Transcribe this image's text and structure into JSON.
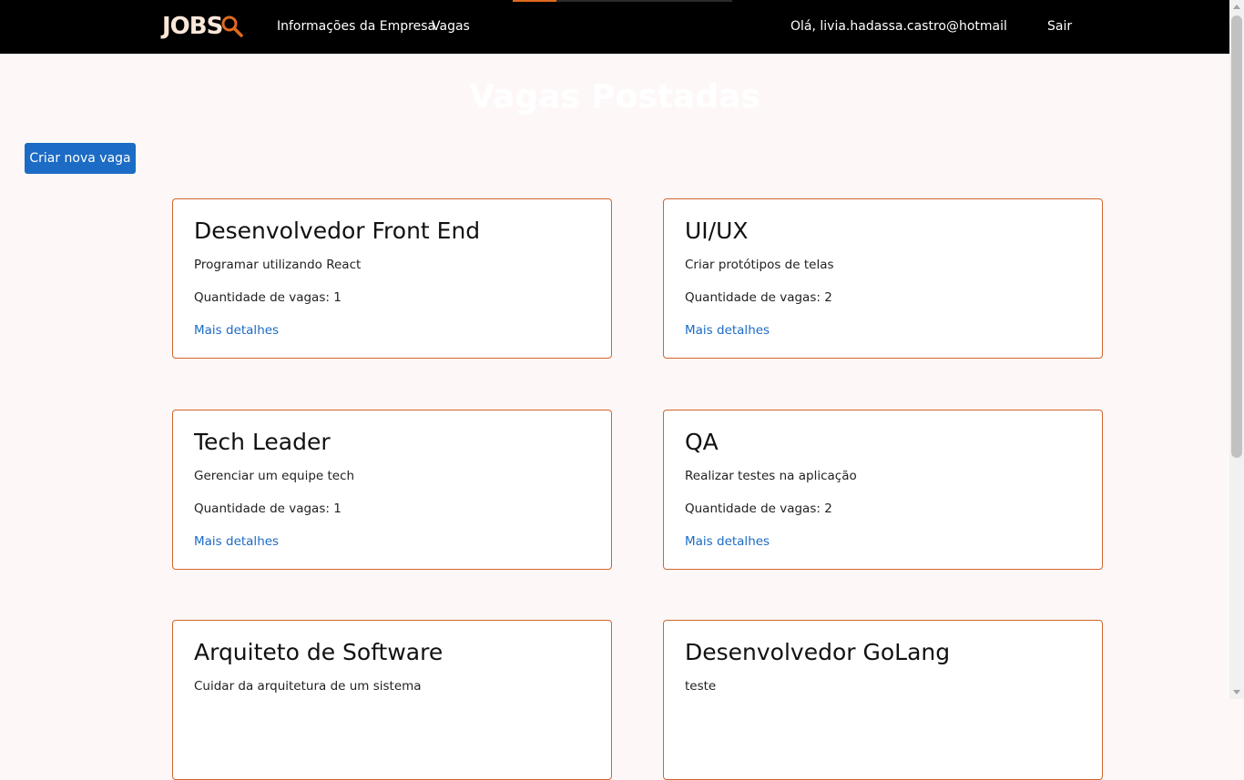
{
  "navbar": {
    "logo_text": "JOBS",
    "links": [
      {
        "label": "Informações da Empresa"
      },
      {
        "label": "Vagas"
      }
    ],
    "greeting": "Olá, livia.hadassa.castro@hotmail",
    "logout_label": "Sair",
    "page_load_progress": 0.2
  },
  "page": {
    "title": "Vagas Postadas",
    "create_button_label": "Criar nova vaga"
  },
  "jobs": [
    {
      "title": "Desenvolvedor Front End",
      "description": "Programar utilizando React",
      "quantity": "Quantidade de vagas: 1",
      "details_label": "Mais detalhes"
    },
    {
      "title": "UI/UX",
      "description": "Criar protótipos de telas",
      "quantity": "Quantidade de vagas: 2",
      "details_label": "Mais detalhes"
    },
    {
      "title": "Tech Leader",
      "description": "Gerenciar um equipe tech",
      "quantity": "Quantidade de vagas: 1",
      "details_label": "Mais detalhes"
    },
    {
      "title": "QA",
      "description": "Realizar testes na aplicação",
      "quantity": "Quantidade de vagas: 2",
      "details_label": "Mais detalhes"
    },
    {
      "title": "Arquiteto de Software",
      "description": "Cuidar da arquitetura de um sistema",
      "quantity": "",
      "details_label": ""
    },
    {
      "title": "Desenvolvedor GoLang",
      "description": "teste",
      "quantity": "",
      "details_label": ""
    }
  ],
  "colors": {
    "navbar_bg": "#000000",
    "card_border": "#d0652b",
    "primary": "#1c6bc5",
    "page_bg": "#fdf8f7",
    "logo_accent": "#e06a1f"
  },
  "icons": {
    "logo_glyph": "magnifier-icon"
  }
}
